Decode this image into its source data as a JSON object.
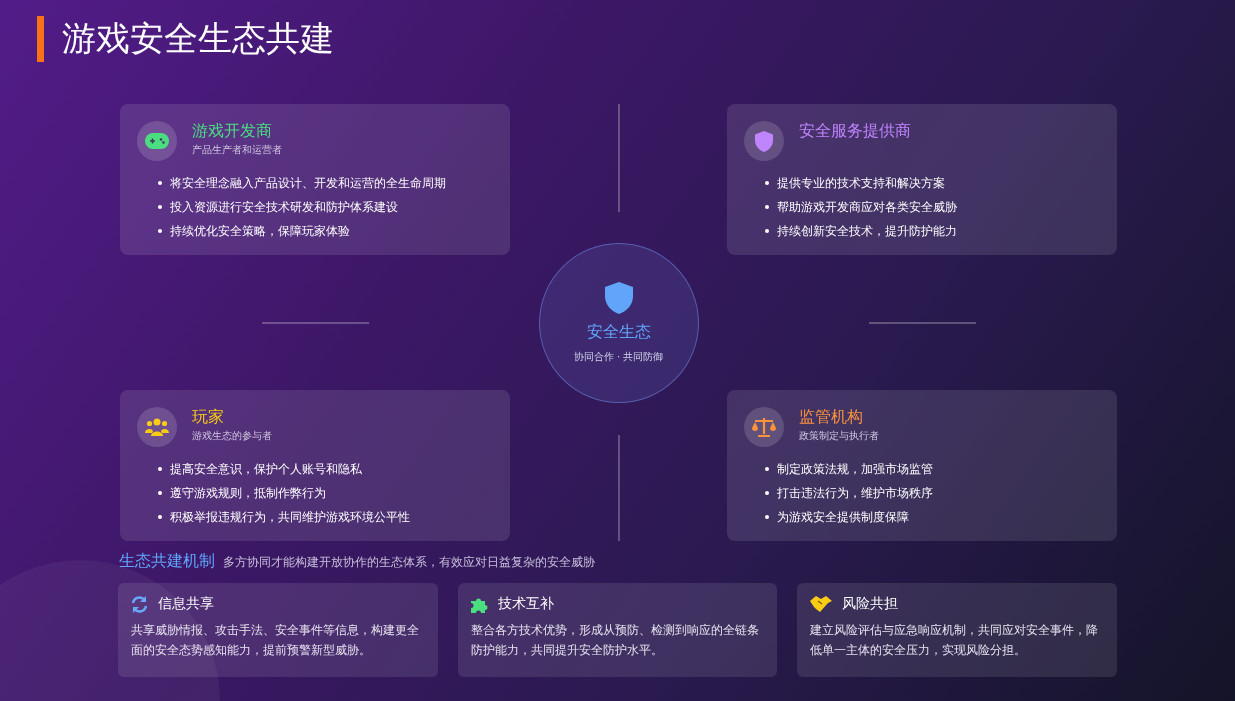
{
  "title": "游戏安全生态共建",
  "roles": [
    {
      "kind": "developer",
      "name": "游戏开发商",
      "subtitle": "产品生产者和运营者",
      "color": "#4ade80",
      "bullets": [
        "将安全理念融入产品设计、开发和运营的全生命周期",
        "投入资源进行安全技术研发和防护体系建设",
        "持续优化安全策略，保障玩家体验"
      ]
    },
    {
      "kind": "security",
      "name": "安全服务提供商",
      "color": "#c084fc",
      "bullets": [
        "提供专业的技术支持和解决方案",
        "帮助游戏开发商应对各类安全威胁",
        "持续创新安全技术，提升防护能力"
      ]
    },
    {
      "kind": "player",
      "name": "玩家",
      "subtitle": "游戏生态的参与者",
      "color": "#facc15",
      "bullets": [
        "提高安全意识，保护个人账号和隐私",
        "遵守游戏规则，抵制作弊行为",
        "积极举报违规行为，共同维护游戏环境公平性"
      ]
    },
    {
      "kind": "regulator",
      "name": "监管机构",
      "subtitle": "政策制定与执行者",
      "color": "#fb923c",
      "bullets": [
        "制定政策法规，加强市场监管",
        "打击违法行为，维护市场秩序",
        "为游戏安全提供制度保障"
      ]
    }
  ],
  "center": {
    "title": "安全生态",
    "subtitle": "协同合作 · 共同防御"
  },
  "mechanism": {
    "title": "生态共建机制",
    "description": "多方协同才能构建开放协作的生态体系，有效应对日益复杂的安全威胁",
    "items": [
      {
        "kind": "sharing",
        "title": "信息共享",
        "text": "共享威胁情报、攻击手法、安全事件等信息，构建更全面的安全态势感知能力，提前预警新型威胁。"
      },
      {
        "kind": "complement",
        "title": "技术互补",
        "text": "整合各方技术优势，形成从预防、检测到响应的全链条防护能力，共同提升安全防护水平。"
      },
      {
        "kind": "risk",
        "title": "风险共担",
        "text": "建立风险评估与应急响应机制，共同应对安全事件，降低单一主体的安全压力，实现风险分担。"
      }
    ]
  }
}
